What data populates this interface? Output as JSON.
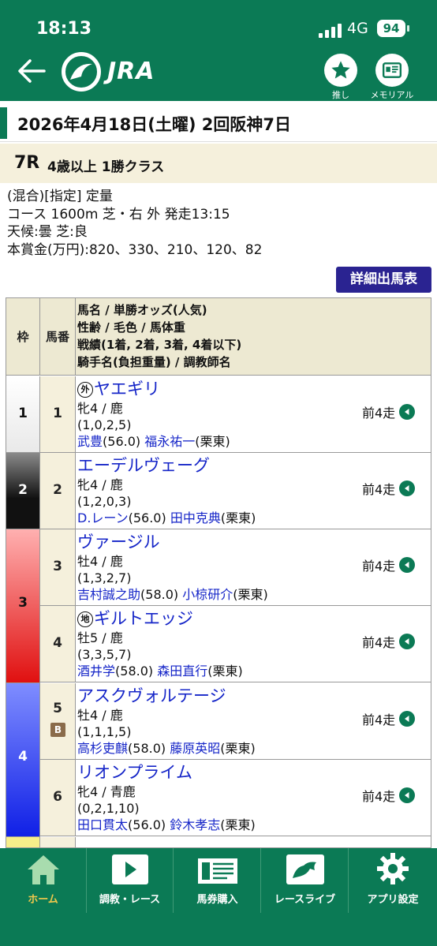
{
  "status": {
    "time": "18:13",
    "network": "4G",
    "battery": "94"
  },
  "header": {
    "logo_text": "JRA",
    "oshi_label": "推し",
    "memorial_label": "メモリアル"
  },
  "race": {
    "date_line": "2026年4月18日(土曜) 2回阪神7日",
    "number": "7R",
    "name": "4歳以上 1勝クラス",
    "info": [
      "(混合)[指定] 定量",
      "コース 1600m 芝・右 外 発走13:15",
      "天候:曇 芝:良",
      "本賞金(万円):820、330、210、120、82"
    ],
    "detail_button": "詳細出馬表"
  },
  "table": {
    "col_waku": "枠",
    "col_umaban": "馬番",
    "col_info_lines": [
      "馬名 / 単勝オッズ(人気)",
      "性齢 / 毛色 / 馬体重",
      "戦績(1着, 2着, 3着, 4着以下)",
      "騎手名(負担重量) / 調教師名"
    ],
    "waku": [
      {
        "label": "1",
        "color": "#ffffff",
        "text_color": "#111111"
      },
      {
        "label": "2",
        "color": "#1a1a1a",
        "text_color": "#ffffff"
      },
      {
        "label": "3",
        "color": "#e8262b",
        "text_color": "#111111"
      },
      {
        "label": "4",
        "color": "#1e3be0",
        "text_color": "#ffffff"
      }
    ],
    "horses": [
      {
        "num": "1",
        "mark": "外",
        "name": "ヤエギリ",
        "sex_age": "牝4 / 鹿",
        "record": "(1,0,2,5)",
        "jockey": "武豊",
        "weight": "(56.0)",
        "trainer": "福永祐一",
        "stable": "(栗東)",
        "prev": "前4走"
      },
      {
        "num": "2",
        "mark": "",
        "name": "エーデルヴェーグ",
        "sex_age": "牝4 / 鹿",
        "record": "(1,2,0,3)",
        "jockey": "D.レーン",
        "weight": "(56.0)",
        "trainer": "田中克典",
        "stable": "(栗東)",
        "prev": "前4走"
      },
      {
        "num": "3",
        "mark": "",
        "name": "ヴァージル",
        "sex_age": "牡4 / 鹿",
        "record": "(1,3,2,7)",
        "jockey": "吉村誠之助",
        "weight": "(58.0)",
        "trainer": "小椋研介",
        "stable": "(栗東)",
        "prev": "前4走"
      },
      {
        "num": "4",
        "mark": "地",
        "name": "ギルトエッジ",
        "sex_age": "牡5 / 鹿",
        "record": "(3,3,5,7)",
        "jockey": "酒井学",
        "weight": "(58.0)",
        "trainer": "森田直行",
        "stable": "(栗東)",
        "prev": "前4走"
      },
      {
        "num": "5",
        "mark": "",
        "blinker": "B",
        "name": "アスクヴォルテージ",
        "sex_age": "牡4 / 鹿",
        "record": "(1,1,1,5)",
        "jockey": "高杉吏麒",
        "weight": "(58.0)",
        "trainer": "藤原英昭",
        "stable": "(栗東)",
        "prev": "前4走"
      },
      {
        "num": "6",
        "mark": "",
        "name": "リオンプライム",
        "sex_age": "牝4 / 青鹿",
        "record": "(0,2,1,10)",
        "jockey": "田口貫太",
        "weight": "(56.0)",
        "trainer": "鈴木孝志",
        "stable": "(栗東)",
        "prev": "前4走"
      }
    ]
  },
  "nav": {
    "home": "ホーム",
    "training": "調教・レース",
    "ticket": "馬券購入",
    "live": "レースライブ",
    "settings": "アプリ設定"
  }
}
